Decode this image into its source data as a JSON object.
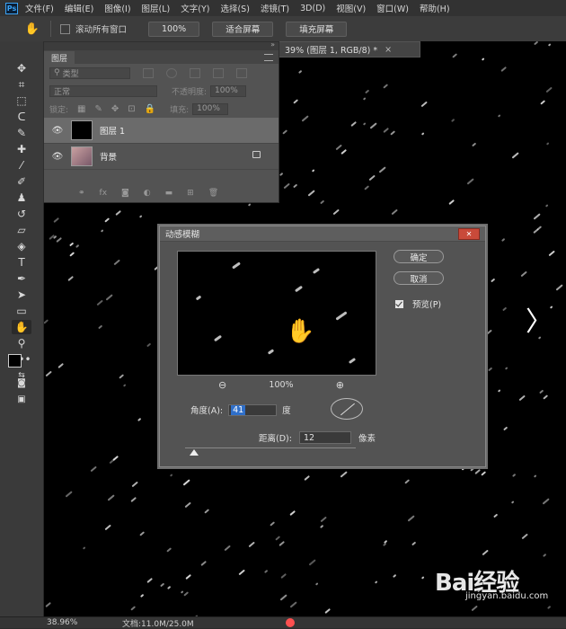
{
  "app": {
    "logo": "Ps"
  },
  "menu": [
    "文件(F)",
    "编辑(E)",
    "图像(I)",
    "图层(L)",
    "文字(Y)",
    "选择(S)",
    "滤镜(T)",
    "3D(D)",
    "视图(V)",
    "窗口(W)",
    "帮助(H)"
  ],
  "options": {
    "tool_icon": "hand-icon",
    "scroll_all_label": "滚动所有窗口",
    "zoom_btn": "100%",
    "fit_btn": "适合屏幕",
    "fill_btn": "填充屏幕"
  },
  "document_tab": {
    "title": "39% (图层 1, RGB/8) *",
    "close": "×"
  },
  "layers_panel": {
    "tab": "图层",
    "filter_placeholder": "类型",
    "blend_mode": "正常",
    "opacity_label": "不透明度:",
    "opacity_value": "100%",
    "lock_label": "锁定:",
    "fill_label": "填充:",
    "fill_value": "100%",
    "layers": [
      {
        "name": "图层 1",
        "selected": true,
        "thumb_color": "#000000"
      },
      {
        "name": "背景",
        "selected": false,
        "locked": true,
        "thumb_color": "#b07a7a"
      }
    ],
    "footer_icons": [
      "link-icon",
      "fx-icon",
      "mask-icon",
      "adjustment-icon",
      "folder-icon",
      "new-layer-icon",
      "trash-icon"
    ],
    "footer_fx": "fx"
  },
  "dialog": {
    "title": "动感模糊",
    "close_icon": "close-icon",
    "ok": "确定",
    "cancel": "取消",
    "preview_label": "预览(P)",
    "preview_checked": true,
    "zoom_percent": "100%",
    "angle_label": "角度(A):",
    "angle_value": "41",
    "angle_unit": "度",
    "distance_label": "距离(D):",
    "distance_value": "12",
    "distance_unit": "像素"
  },
  "status": {
    "zoom": "38.96%",
    "doc": "文档:11.0M/25.0M"
  },
  "watermark": {
    "brand": "Bai经验",
    "url": "jingyan.baidu.com"
  },
  "colors": {
    "accent": "#2f6fc9",
    "close": "#c94a3a",
    "canvas": "#000000"
  }
}
